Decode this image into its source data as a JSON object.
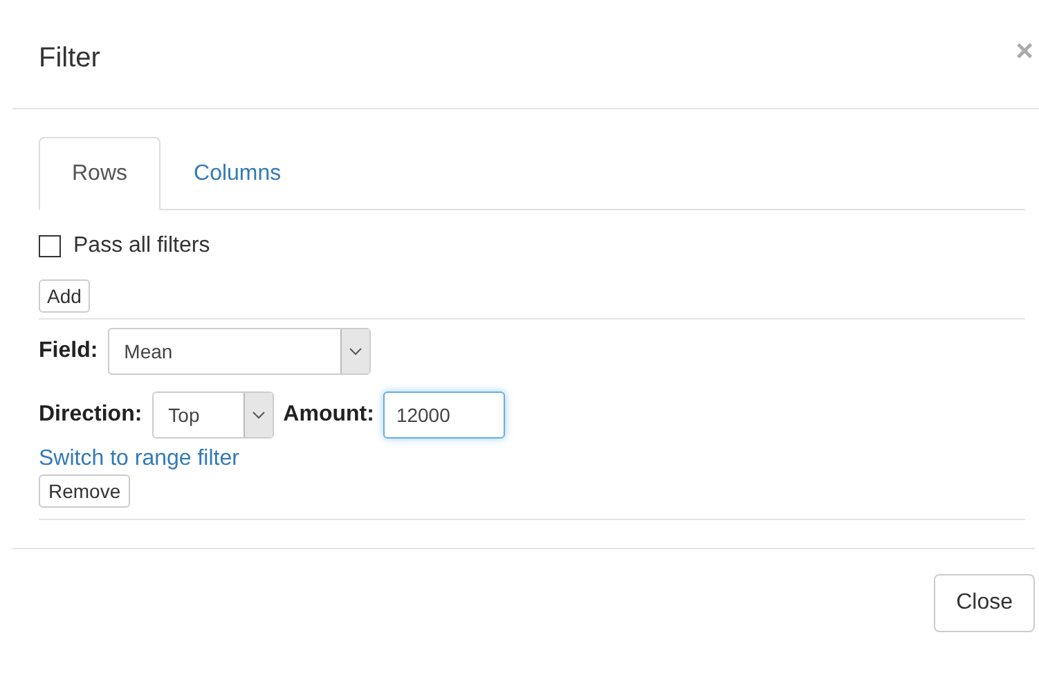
{
  "dialog": {
    "title": "Filter",
    "close_glyph": "×"
  },
  "tabs": [
    {
      "label": "Rows",
      "selected": true
    },
    {
      "label": "Columns",
      "selected": false
    }
  ],
  "pass_all": {
    "label": "Pass all filters",
    "checked": false
  },
  "add_button": "Add",
  "filter": {
    "field_label": "Field:",
    "field_value": "Mean",
    "direction_label": "Direction:",
    "direction_value": "Top",
    "amount_label": "Amount:",
    "amount_value": "12000",
    "amount_focused": true,
    "switch_link": "Switch to range filter",
    "remove_button": "Remove"
  },
  "footer": {
    "close_button": "Close"
  }
}
